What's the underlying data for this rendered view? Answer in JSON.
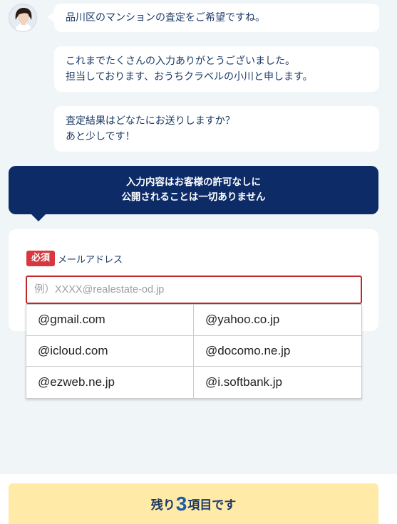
{
  "chat": {
    "messages": [
      {
        "lines": [
          "品川区のマンションの査定をご希望ですね。"
        ]
      },
      {
        "lines": [
          "これまでたくさんの入力ありがとうございました。",
          "担当しております、おうちクラベルの小川と申します。"
        ]
      },
      {
        "lines": [
          "査定結果はどなたにお送りしますか？",
          "あと少しです！"
        ]
      }
    ]
  },
  "notice": {
    "lines": [
      "入力内容はお客様の許可なしに",
      "公開されることは一切ありません"
    ],
    "color": "#0d2b66"
  },
  "form": {
    "required_badge": "必須",
    "field_label": "メールアドレス",
    "email_value": "",
    "email_placeholder": "例）XXXX@realestate-od.jp",
    "suggestions": [
      "@gmail.com",
      "@yahoo.co.jp",
      "@icloud.com",
      "@docomo.ne.jp",
      "@ezweb.ne.jp",
      "@i.softbank.jp"
    ]
  },
  "progress": {
    "prefix": "残り",
    "count": "3",
    "suffix": "項目です"
  },
  "colors": {
    "accent_navy": "#0d2b66",
    "required_red": "#d7373f",
    "progress_yellow": "#ffeaa8",
    "background": "#f0f5f8"
  },
  "icons": {
    "avatar": "operator-avatar"
  }
}
